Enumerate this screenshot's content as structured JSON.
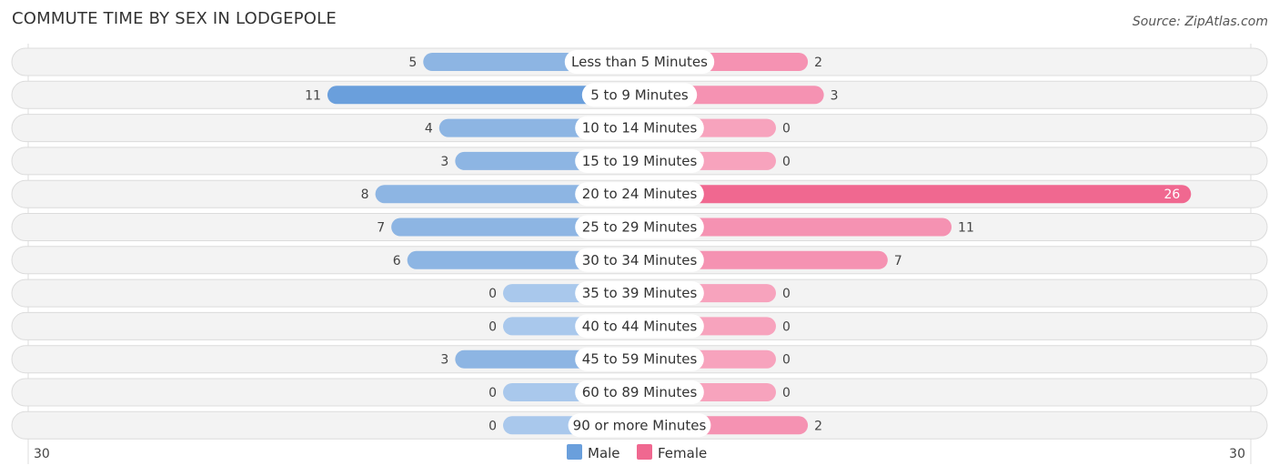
{
  "title": "COMMUTE TIME BY SEX IN LODGEPOLE",
  "source": "Source: ZipAtlas.com",
  "colors": {
    "male": "#6a9fdc",
    "male_light": "#a9c8ec",
    "female": "#f06890",
    "female_light": "#f7a3bd"
  },
  "chart_data": {
    "type": "bar",
    "orientation": "horizontal-diverging",
    "title": "COMMUTE TIME BY SEX IN LODGEPOLE",
    "categories": [
      "Less than 5 Minutes",
      "5 to 9 Minutes",
      "10 to 14 Minutes",
      "15 to 19 Minutes",
      "20 to 24 Minutes",
      "25 to 29 Minutes",
      "30 to 34 Minutes",
      "35 to 39 Minutes",
      "40 to 44 Minutes",
      "45 to 59 Minutes",
      "60 to 89 Minutes",
      "90 or more Minutes"
    ],
    "series": [
      {
        "name": "Male",
        "values": [
          5,
          11,
          4,
          3,
          8,
          7,
          6,
          0,
          0,
          3,
          0,
          0
        ]
      },
      {
        "name": "Female",
        "values": [
          2,
          3,
          0,
          0,
          26,
          11,
          7,
          0,
          0,
          0,
          0,
          2
        ]
      }
    ],
    "axis": {
      "left_label": "30",
      "right_label": "30",
      "max": 30
    },
    "legend": {
      "position": "bottom-center",
      "items": [
        "Male",
        "Female"
      ]
    }
  }
}
